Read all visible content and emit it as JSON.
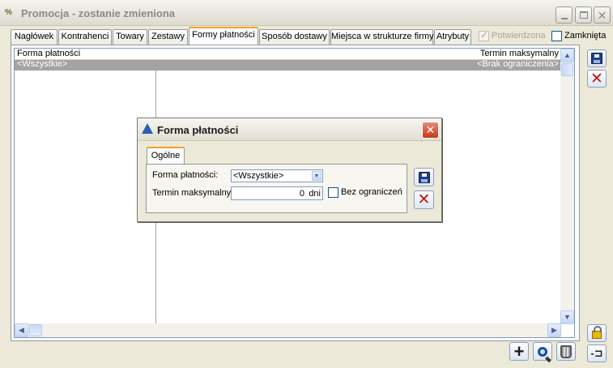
{
  "window": {
    "app_icon": "%",
    "title": "Promocja - zostanie zmieniona",
    "controls": {
      "minimize": "minimize-icon",
      "maximize": "maximize-icon",
      "close": "close-icon"
    }
  },
  "tabs": [
    {
      "label": "Nagłówek"
    },
    {
      "label": "Kontrahenci"
    },
    {
      "label": "Towary"
    },
    {
      "label": "Zestawy"
    },
    {
      "label": "Formy płatności",
      "active": true
    },
    {
      "label": "Sposób dostawy"
    },
    {
      "label": "Miejsca w strukturze firmy"
    },
    {
      "label": "Atrybuty"
    }
  ],
  "checkboxes": {
    "potwierdzona": {
      "label": "Potwierdzona",
      "checked": true,
      "disabled": true
    },
    "zamknieta": {
      "label": "Zamknięta",
      "checked": false,
      "disabled": false
    }
  },
  "grid": {
    "columns": [
      "Forma płatności",
      "Termin maksymalny"
    ],
    "rows": [
      {
        "forma": "<Wszystkie>",
        "termin": "<Brak ograniczenia>",
        "selected": true
      }
    ]
  },
  "dialog": {
    "title": "Forma płatności",
    "tab": "Ogólne",
    "forma_label": "Forma płatności:",
    "forma_value": "<Wszystkie>",
    "termin_label": "Termin maksymalny:",
    "termin_value": "0",
    "termin_unit": "dni",
    "bez_label": "Bez ograniczeń",
    "bez_checked": false
  },
  "icons": {
    "save": "floppy-disk-icon",
    "cancel": "red-x-icon",
    "add": "plus-icon",
    "search": "magnifier-icon",
    "delete": "trash-icon",
    "lock": "padlock-icon",
    "pin": "pin-icon"
  },
  "colors": {
    "active_tab_accent": "#f4a228",
    "selected_row": "#a3a3a3",
    "window_bg": "#ece9d8",
    "dialog_close": "#c6391e"
  }
}
